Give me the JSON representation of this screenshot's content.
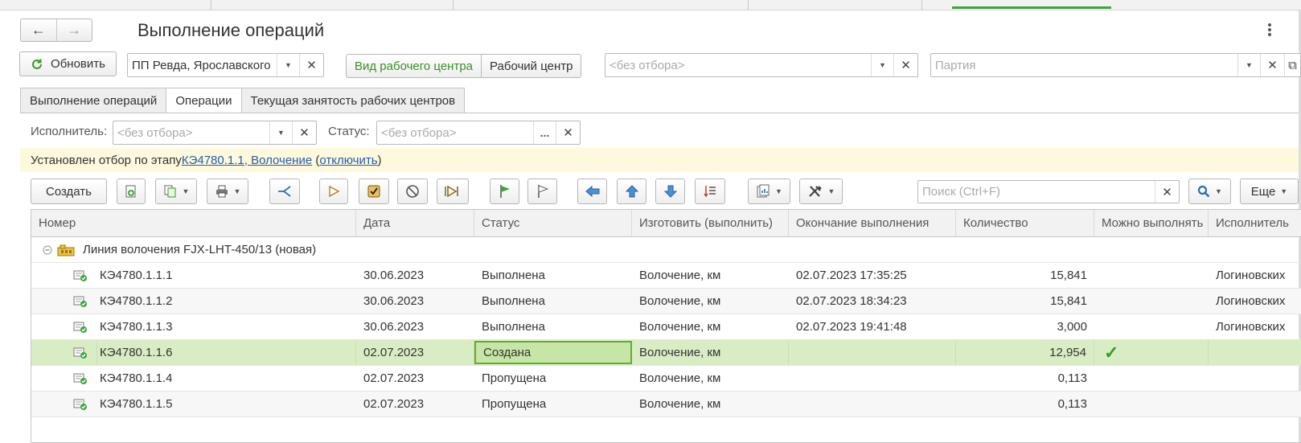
{
  "window": {
    "title": "Выполнение операций",
    "more_icon": "more-vertical-icon"
  },
  "filters": {
    "refresh_label": "Обновить",
    "department_value": "ПП Ревда, Ярославского",
    "segment_type": "Вид рабочего центра",
    "segment_center": "Рабочий центр",
    "center_placeholder": "<без отбора>",
    "batch_placeholder": "Партия"
  },
  "tabs": [
    {
      "label": "Выполнение операций",
      "active": false
    },
    {
      "label": "Операции",
      "active": true
    },
    {
      "label": "Текущая занятость рабочих центров",
      "active": false
    }
  ],
  "subfilters": {
    "executor_label": "Исполнитель:",
    "executor_placeholder": "<без отбора>",
    "status_label": "Статус:",
    "status_placeholder": "<без отбора>",
    "status_select": "..."
  },
  "notice": {
    "prefix": "Установлен отбор по этапу ",
    "link": "КЭ4780.1.1, Волочение",
    "open": " (",
    "disable": "отключить",
    "close": ")"
  },
  "toolbar": {
    "create_label": "Создать",
    "search_placeholder": "Поиск (Ctrl+F)",
    "more_label": "Еще"
  },
  "table": {
    "columns": [
      "Номер",
      "Дата",
      "Статус",
      "Изготовить (выполнить)",
      "Окончание выполнения",
      "Количество",
      "Можно выполнять",
      "Исполнитель"
    ],
    "group": "Линия волочения FJX-LHT-450/13 (новая)",
    "rows": [
      {
        "number": "КЭ4780.1.1.1",
        "date": "30.06.2023",
        "status": "Выполнена",
        "produce": "Волочение, км",
        "end": "02.07.2023 17:35:25",
        "qty": "15,841",
        "can_run": "",
        "executor": "Логиновских"
      },
      {
        "number": "КЭ4780.1.1.2",
        "date": "30.06.2023",
        "status": "Выполнена",
        "produce": "Волочение, км",
        "end": "02.07.2023 18:34:23",
        "qty": "15,841",
        "can_run": "",
        "executor": "Логиновских"
      },
      {
        "number": "КЭ4780.1.1.3",
        "date": "30.06.2023",
        "status": "Выполнена",
        "produce": "Волочение, км",
        "end": "02.07.2023 19:41:48",
        "qty": "3,000",
        "can_run": "",
        "executor": "Логиновских"
      },
      {
        "number": "КЭ4780.1.1.6",
        "date": "02.07.2023",
        "status": "Создана",
        "produce": "Волочение, км",
        "end": "",
        "qty": "12,954",
        "can_run": "✓",
        "executor": ""
      },
      {
        "number": "КЭ4780.1.1.4",
        "date": "02.07.2023",
        "status": "Пропущена",
        "produce": "Волочение, км",
        "end": "",
        "qty": "0,113",
        "can_run": "",
        "executor": ""
      },
      {
        "number": "КЭ4780.1.1.5",
        "date": "02.07.2023",
        "status": "Пропущена",
        "produce": "Волочение, км",
        "end": "",
        "qty": "0,113",
        "can_run": "",
        "executor": ""
      }
    ]
  },
  "colors": {
    "accent_green": "#3a8f26",
    "selected_row": "#d9edc4",
    "notice_bg": "#fdf9dd",
    "link": "#2a5cab"
  }
}
